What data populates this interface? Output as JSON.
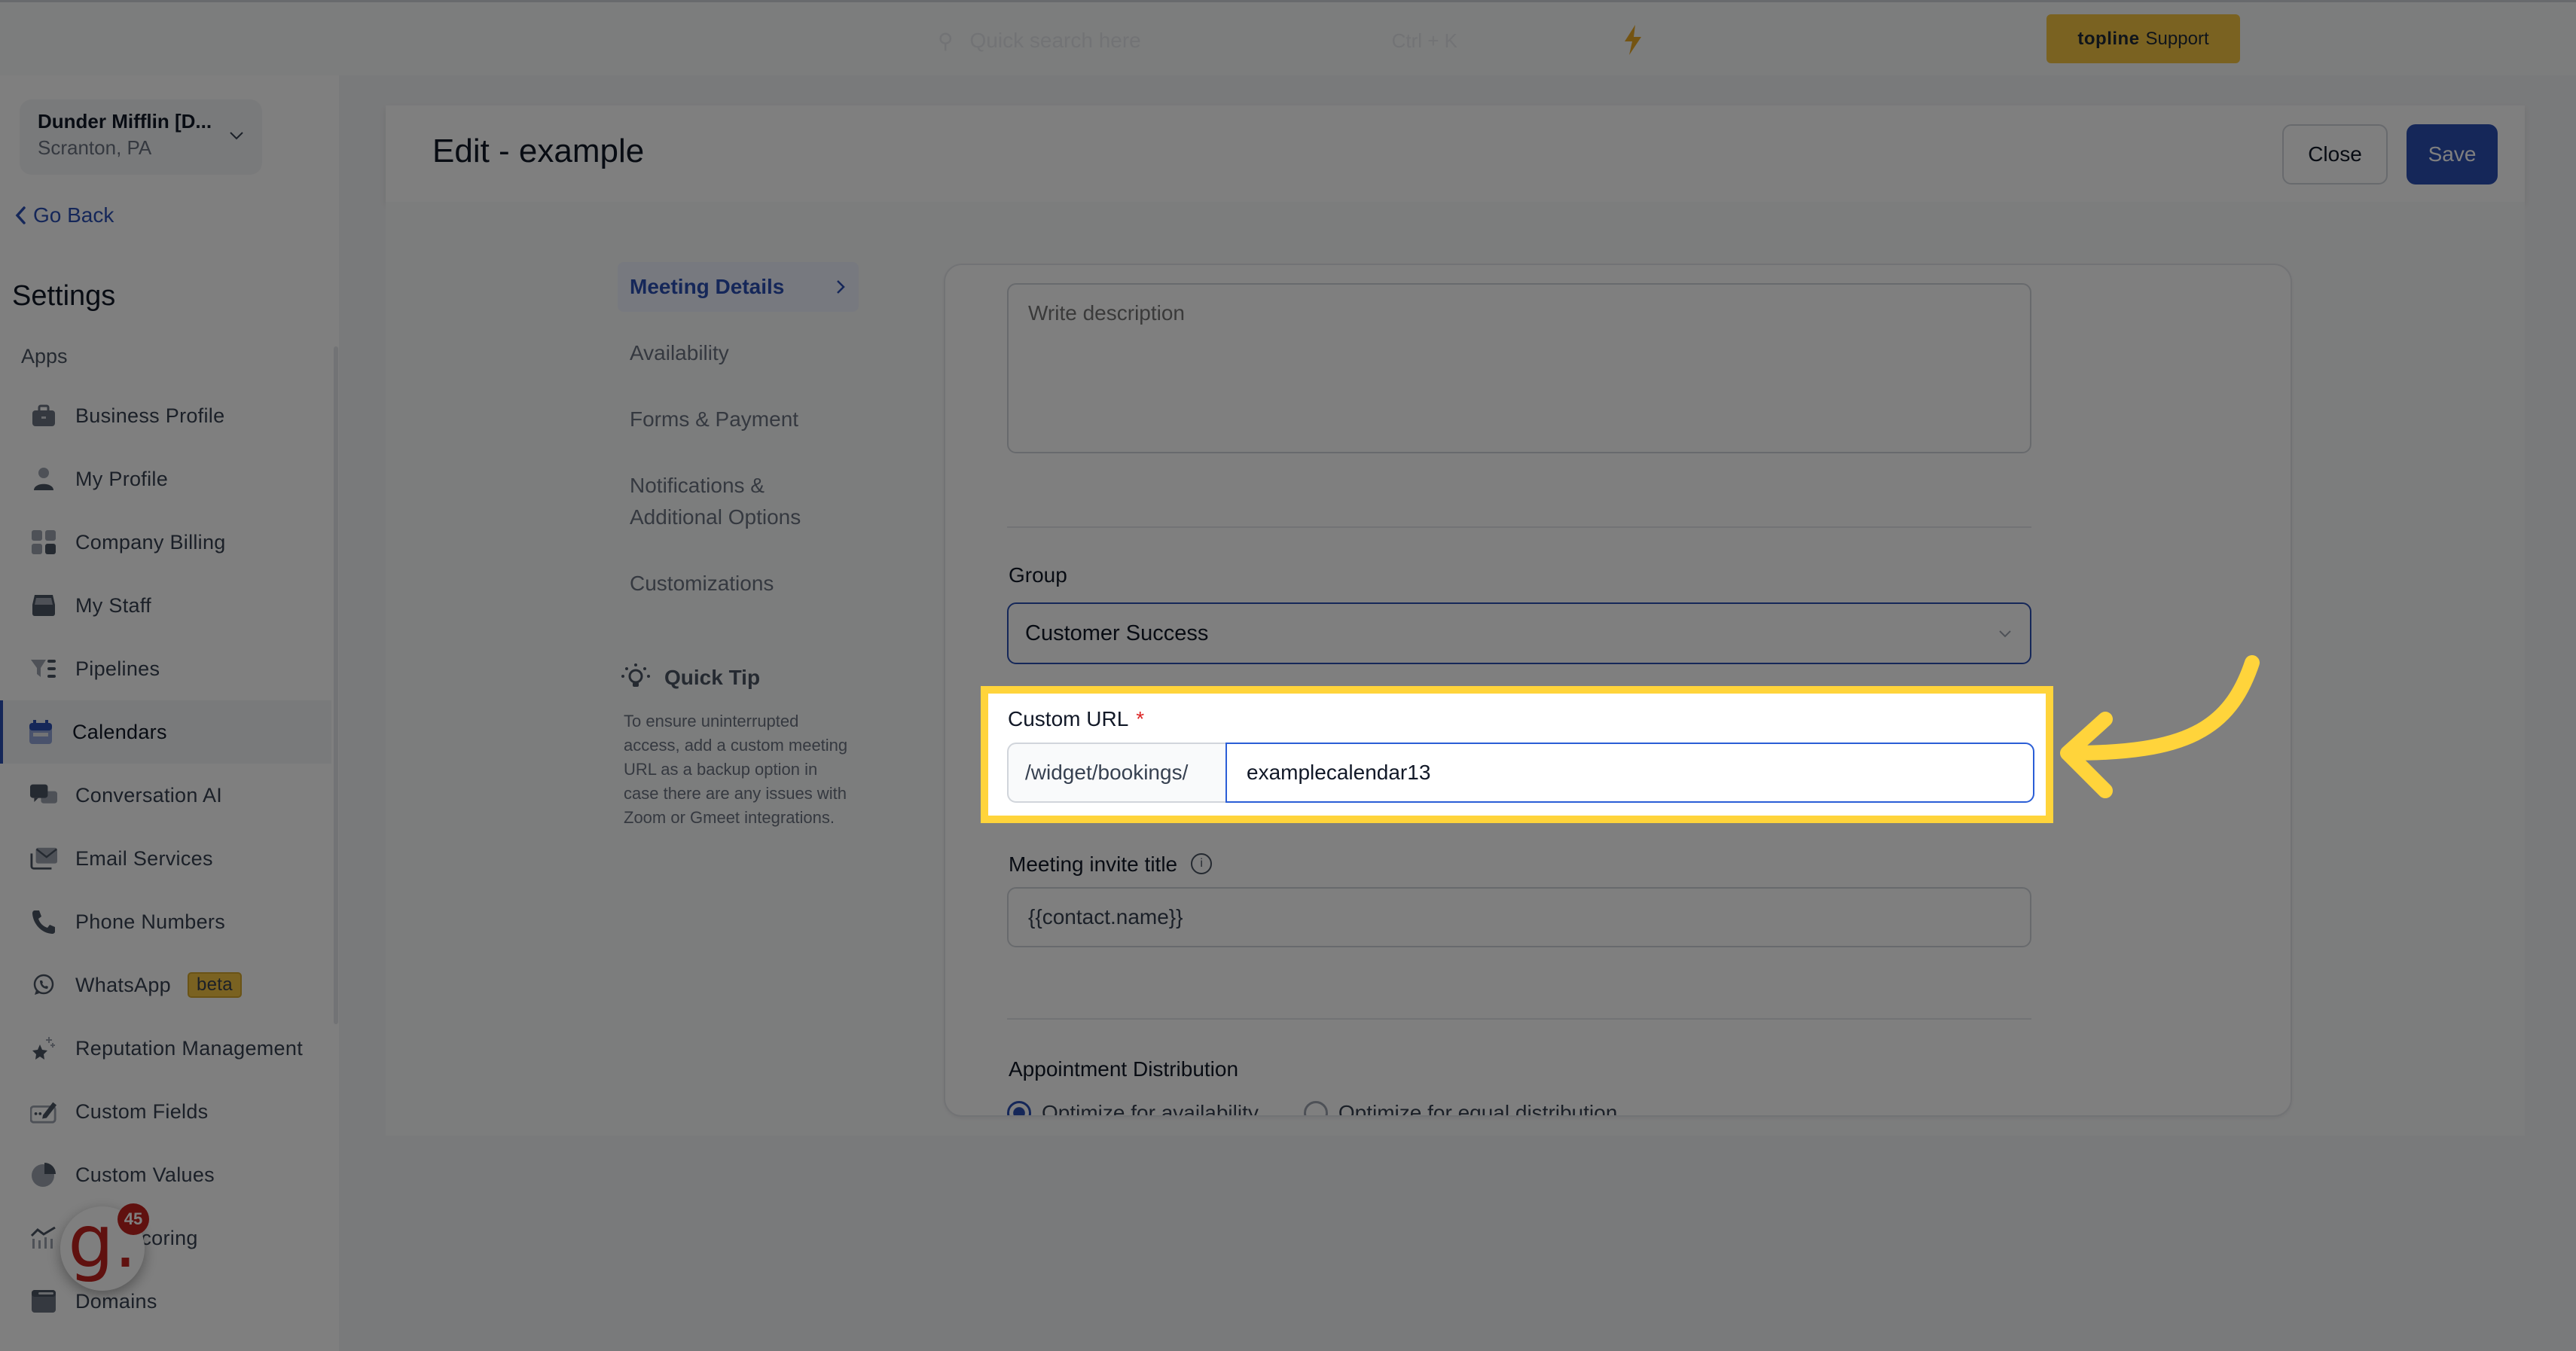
{
  "topbar": {
    "search_placeholder": "Quick search here",
    "search_shortcut": "Ctrl + K",
    "support_brand": "topline",
    "support_label": "Support",
    "bolt_icon": "lightning-icon"
  },
  "sidebar": {
    "location_name": "Dunder Mifflin [D...",
    "location_sub": "Scranton, PA",
    "go_back": "Go Back",
    "title": "Settings",
    "section": "Apps",
    "items": [
      {
        "label": "Business Profile",
        "icon": "briefcase-icon"
      },
      {
        "label": "My Profile",
        "icon": "user-icon"
      },
      {
        "label": "Company Billing",
        "icon": "calculator-icon"
      },
      {
        "label": "My Staff",
        "icon": "inbox-icon"
      },
      {
        "label": "Pipelines",
        "icon": "filter-icon"
      },
      {
        "label": "Calendars",
        "icon": "calendar-icon",
        "active": true
      },
      {
        "label": "Conversation AI",
        "icon": "chat-icon"
      },
      {
        "label": "Email Services",
        "icon": "mail-icon"
      },
      {
        "label": "Phone Numbers",
        "icon": "phone-icon"
      },
      {
        "label": "WhatsApp",
        "icon": "whatsapp-icon",
        "badge": "beta"
      },
      {
        "label": "Reputation Management",
        "icon": "star-icon"
      },
      {
        "label": "Custom Fields",
        "icon": "edit-field-icon"
      },
      {
        "label": "Custom Values",
        "icon": "pie-icon"
      },
      {
        "label": "Lead Scoring",
        "icon": "chart-icon"
      },
      {
        "label": "Domains",
        "icon": "browser-icon"
      }
    ],
    "fab_letter": "g.",
    "fab_badge": "45"
  },
  "header": {
    "title": "Edit - example",
    "close_label": "Close",
    "save_label": "Save"
  },
  "subnav": {
    "items": [
      {
        "label": "Meeting Details",
        "active": true
      },
      {
        "label": "Availability"
      },
      {
        "label": "Forms & Payment"
      },
      {
        "label": "Notifications & Additional Options"
      },
      {
        "label": "Customizations"
      }
    ]
  },
  "quick_tip": {
    "title": "Quick Tip",
    "body": "To ensure uninterrupted access, add a custom meeting URL as a backup option in case there are any issues with Zoom or Gmeet integrations."
  },
  "form": {
    "description_placeholder": "Write description",
    "group_label": "Group",
    "group_value": "Customer Success",
    "custom_url_label": "Custom URL",
    "required_mark": "*",
    "url_prefix": "/widget/bookings/",
    "url_value": "examplecalendar13",
    "invite_title_label": "Meeting invite title",
    "invite_title_value": "{{contact.name}}",
    "distribution_label": "Appointment Distribution",
    "distribution_options": [
      "Optimize for availability",
      "Optimize for equal distribution"
    ],
    "distribution_selected": 0
  },
  "colors": {
    "accent": "#2b4eb3",
    "highlight": "#ffd43b",
    "support_bg": "#f5c542",
    "required": "#dc2626"
  }
}
